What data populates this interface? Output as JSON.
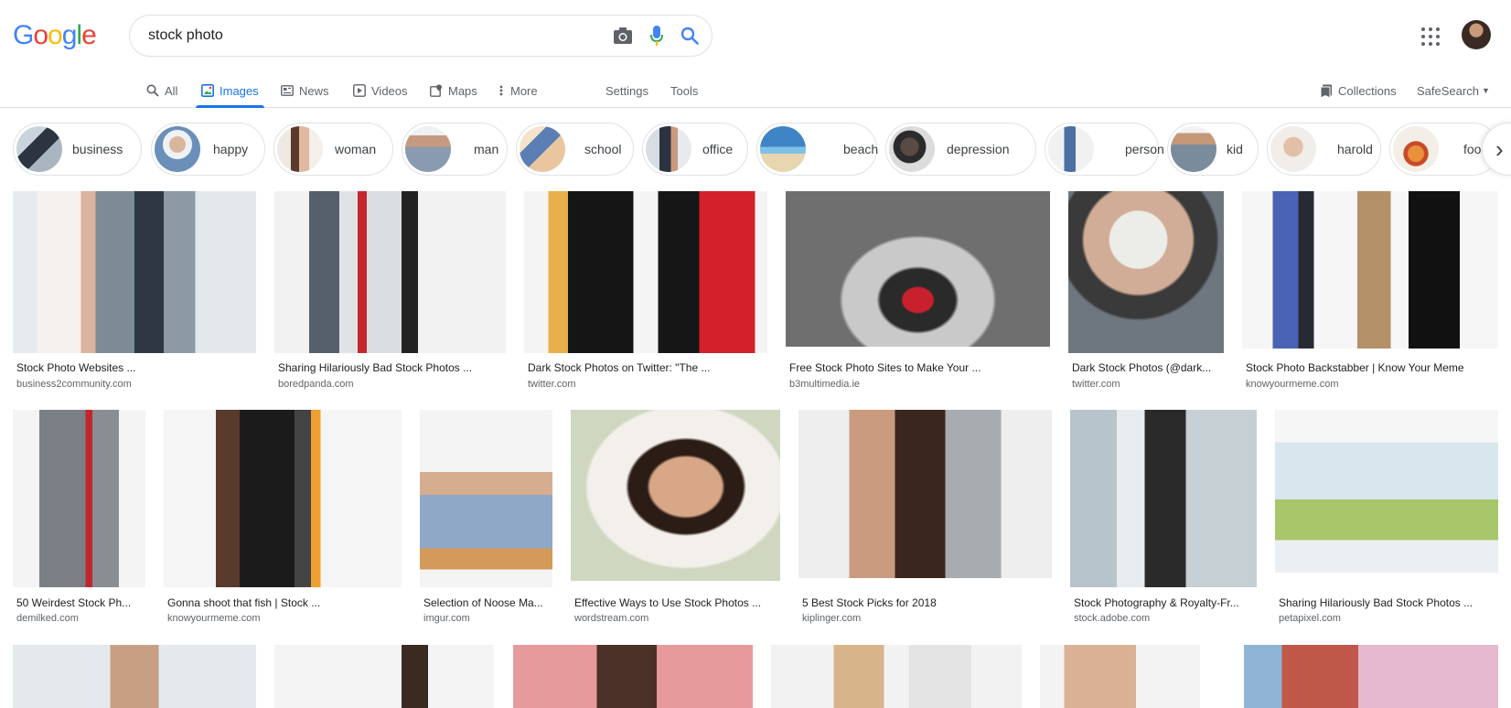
{
  "logo": {
    "letters": [
      "G",
      "o",
      "o",
      "g",
      "l",
      "e"
    ],
    "colors": [
      "#4285f4",
      "#ea4335",
      "#fbbc05",
      "#4285f4",
      "#34a853",
      "#ea4335"
    ]
  },
  "search": {
    "value": "stock photo",
    "icons": [
      "camera-icon",
      "microphone-icon",
      "search-icon"
    ]
  },
  "nav": {
    "tabs": [
      {
        "label": "All",
        "icon": "search-icon"
      },
      {
        "label": "Images",
        "icon": "image-icon",
        "active": true
      },
      {
        "label": "News",
        "icon": "news-icon"
      },
      {
        "label": "Videos",
        "icon": "video-icon"
      },
      {
        "label": "Maps",
        "icon": "map-icon"
      },
      {
        "label": "More",
        "icon": "more-vertical-icon"
      }
    ],
    "settings": "Settings",
    "tools": "Tools",
    "collections": "Collections",
    "safesearch": "SafeSearch"
  },
  "chips": [
    {
      "label": "business"
    },
    {
      "label": "happy"
    },
    {
      "label": "woman"
    },
    {
      "label": "man"
    },
    {
      "label": "school"
    },
    {
      "label": "office"
    },
    {
      "label": "beach"
    },
    {
      "label": "depression"
    },
    {
      "label": "person"
    },
    {
      "label": "kid"
    },
    {
      "label": "harold"
    },
    {
      "label": "food"
    }
  ],
  "results": [
    {
      "title": "Stock Photo Websites ...",
      "source": "business2community.com"
    },
    {
      "title": "Sharing Hilariously Bad Stock Photos ...",
      "source": "boredpanda.com"
    },
    {
      "title": "Dark Stock Photos on Twitter: \"The ...",
      "source": "twitter.com"
    },
    {
      "title": "Free Stock Photo Sites to Make Your ...",
      "source": "b3multimedia.ie"
    },
    {
      "title": "Dark Stock Photos (@dark...",
      "source": "twitter.com"
    },
    {
      "title": "Stock Photo Backstabber | Know Your Meme",
      "source": "knowyourmeme.com"
    },
    {
      "title": "50 Weirdest Stock Ph...",
      "source": "demilked.com"
    },
    {
      "title": "Gonna shoot that fish | Stock ...",
      "source": "knowyourmeme.com"
    },
    {
      "title": "Selection of Noose Ma...",
      "source": "imgur.com"
    },
    {
      "title": "Effective Ways to Use Stock Photos ...",
      "source": "wordstream.com"
    },
    {
      "title": "5 Best Stock Picks for 2018",
      "source": "kiplinger.com"
    },
    {
      "title": "Stock Photography & Royalty-Fr...",
      "source": "stock.adobe.com"
    },
    {
      "title": "Sharing Hilariously Bad Stock Photos ...",
      "source": "petapixel.com"
    }
  ]
}
